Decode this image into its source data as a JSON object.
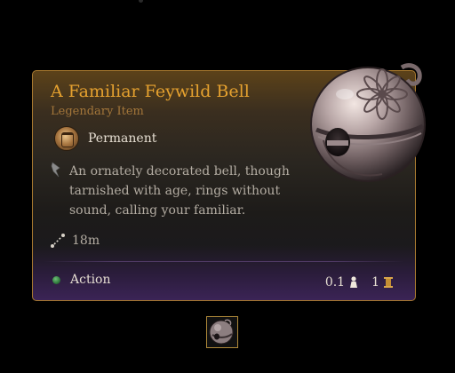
{
  "item": {
    "name": "A Familiar Feywild Bell",
    "rarity": "Legendary Item",
    "duration": "Permanent",
    "description": "An ornately decorated bell, though tarnished with age, rings without sound, calling your familiar.",
    "range": "18m",
    "action": "Action",
    "weight": "0.1",
    "value": "1"
  },
  "icons": {
    "bell": "bell-item-icon",
    "permanent": "permanent-effect-icon",
    "description": "quill-icon",
    "range": "range-icon",
    "action": "action-resource-icon",
    "weight": "weight-icon",
    "value": "gold-coin-icon",
    "slot": "equipped-item-slot-icon"
  },
  "colors": {
    "title": "#e5a12f",
    "rarity": "#a3763a",
    "border": "#a8792f",
    "action_dot": "#2f7a3c"
  }
}
